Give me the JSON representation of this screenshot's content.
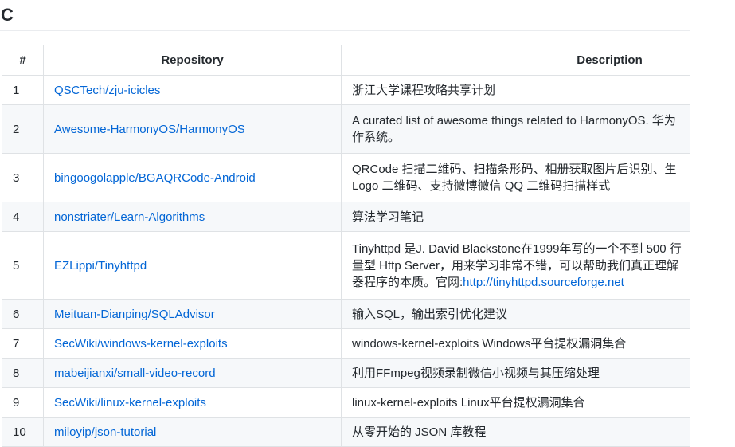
{
  "section": {
    "heading": "C"
  },
  "table": {
    "headers": {
      "num": "#",
      "repository": "Repository",
      "description": "Description"
    },
    "rows": [
      {
        "num": "1",
        "repo": "QSCTech/zju-icicles",
        "desc": "浙江大学课程攻略共享计划"
      },
      {
        "num": "2",
        "repo": "Awesome-HarmonyOS/HarmonyOS",
        "desc_l1": "A curated list of awesome things related to HarmonyOS. 华为",
        "desc_l2": "作系统。"
      },
      {
        "num": "3",
        "repo": "bingoogolapple/BGAQRCode-Android",
        "desc_l1": "QRCode 扫描二维码、扫描条形码、相册获取图片后识别、生",
        "desc_l2": "Logo 二维码、支持微博微信 QQ 二维码扫描样式"
      },
      {
        "num": "4",
        "repo": "nonstriater/Learn-Algorithms",
        "desc": "算法学习笔记"
      },
      {
        "num": "5",
        "repo": "EZLippi/Tinyhttpd",
        "desc_l1": "Tinyhttpd 是J. David Blackstone在1999年写的一个不到 500 行",
        "desc_l2": "量型 Http Server，用来学习非常不错，可以帮助我们真正理解",
        "desc_l3_prefix": "器程序的本质。官网:",
        "desc_l3_link": "http://tinyhttpd.sourceforge.net"
      },
      {
        "num": "6",
        "repo": "Meituan-Dianping/SQLAdvisor",
        "desc": "输入SQL，输出索引优化建议"
      },
      {
        "num": "7",
        "repo": "SecWiki/windows-kernel-exploits",
        "desc": "windows-kernel-exploits Windows平台提权漏洞集合"
      },
      {
        "num": "8",
        "repo": "mabeijianxi/small-video-record",
        "desc": "利用FFmpeg视频录制微信小视频与其压缩处理"
      },
      {
        "num": "9",
        "repo": "SecWiki/linux-kernel-exploits",
        "desc": "linux-kernel-exploits Linux平台提权漏洞集合"
      },
      {
        "num": "10",
        "repo": "miloyip/json-tutorial",
        "desc": "从零开始的 JSON 库教程"
      }
    ]
  },
  "colors": {
    "link": "#0366d6",
    "text": "#24292e",
    "border": "#dfe2e5",
    "row_alt_bg": "#f6f8fa"
  }
}
